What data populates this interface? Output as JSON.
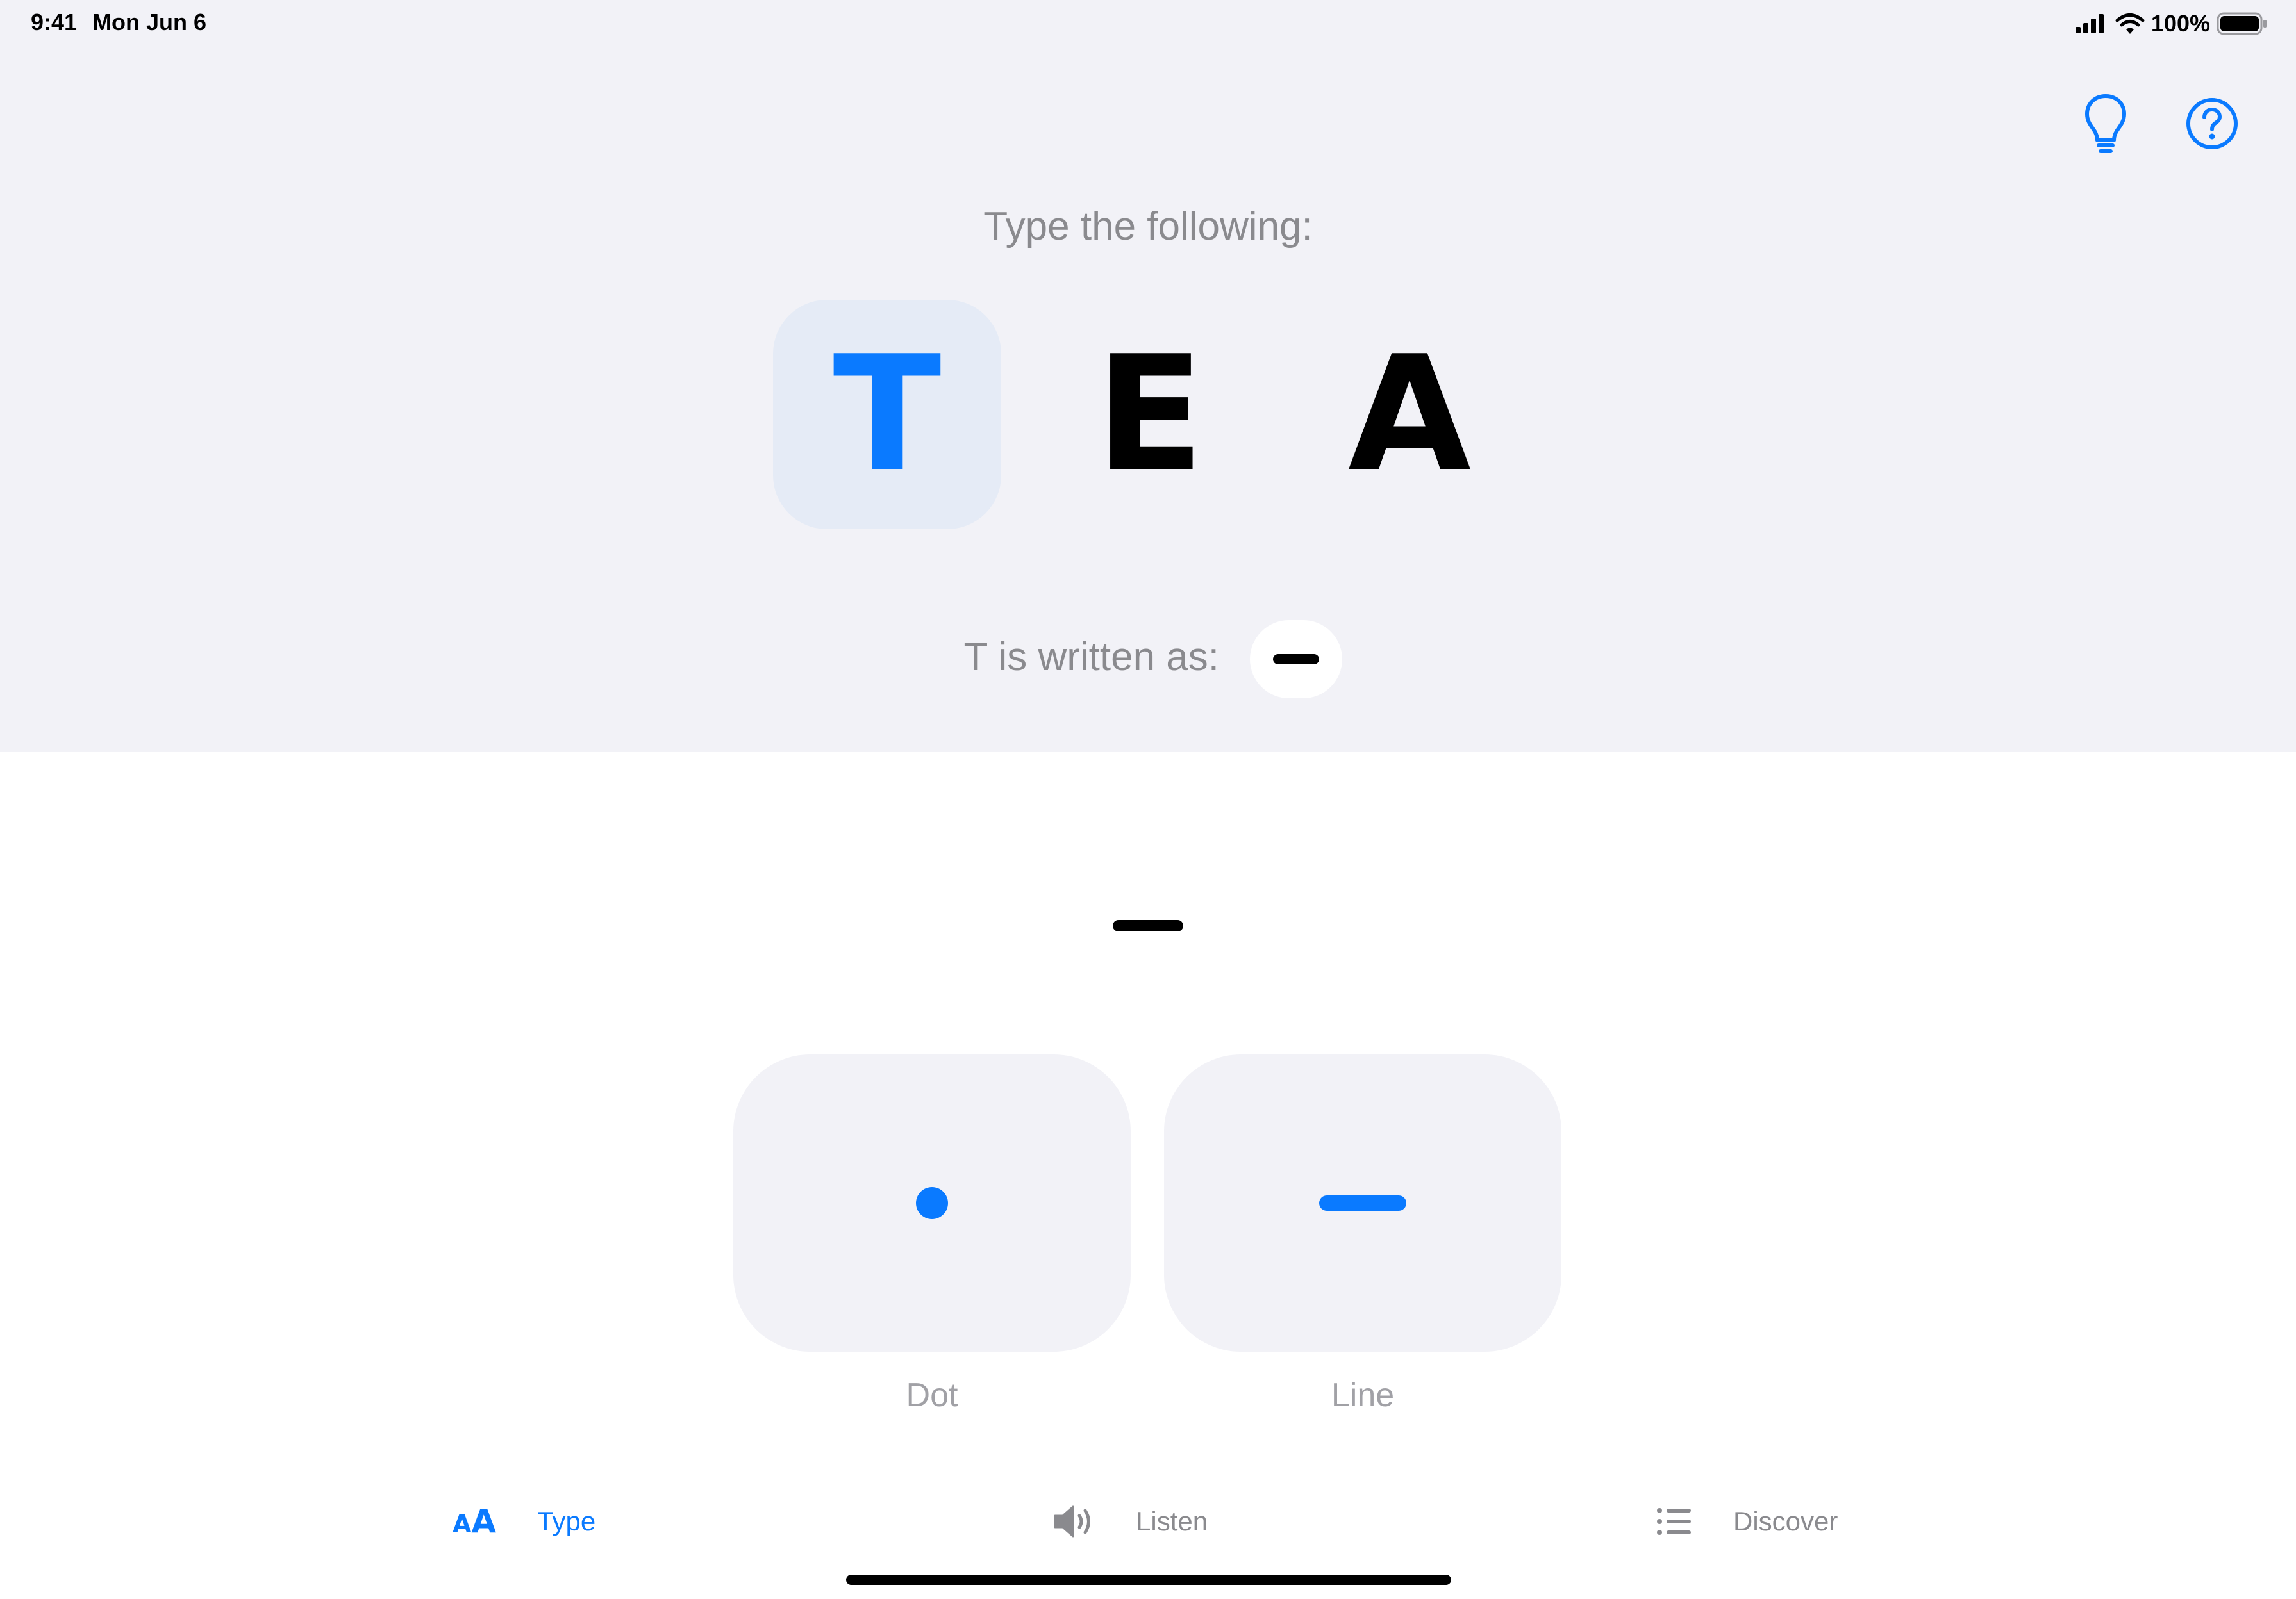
{
  "status_bar": {
    "time": "9:41",
    "date": "Mon Jun 6",
    "battery_percent": "100%",
    "icons": [
      "signal-icon",
      "wifi-icon",
      "battery-icon"
    ]
  },
  "toolbar": {
    "hint_icon": "lightbulb-icon",
    "help_icon": "question-circle-icon"
  },
  "prompt": "Type the following:",
  "target_letters": [
    {
      "char": "T",
      "active": true
    },
    {
      "char": "E",
      "active": false
    },
    {
      "char": "A",
      "active": false
    }
  ],
  "written_as": {
    "label": "T is written as:",
    "code": [
      "line"
    ]
  },
  "typed_input": [
    "line"
  ],
  "keys": {
    "dot": {
      "label": "Dot",
      "icon": "dot-icon"
    },
    "line": {
      "label": "Line",
      "icon": "line-icon"
    }
  },
  "tabs": [
    {
      "label": "Type",
      "icon": "text-size-icon",
      "selected": true
    },
    {
      "label": "Listen",
      "icon": "speaker-icon",
      "selected": false
    },
    {
      "label": "Discover",
      "icon": "list-icon",
      "selected": false
    }
  ],
  "colors": {
    "accent": "#0a7aff",
    "top_background": "#f2f2f7",
    "active_tile": "#e5ebf6",
    "secondary_text": "#8a8a8e"
  }
}
